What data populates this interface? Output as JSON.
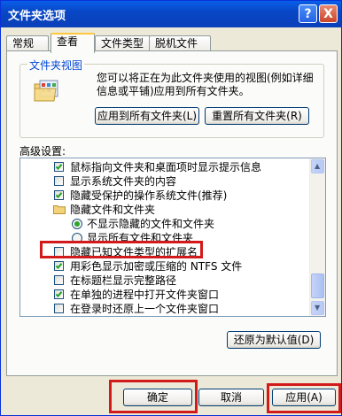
{
  "window": {
    "title": "文件夹选项",
    "help_label": "?",
    "close_label": "X"
  },
  "tabs": [
    {
      "label": "常规"
    },
    {
      "label": "查看"
    },
    {
      "label": "文件类型"
    },
    {
      "label": "脱机文件"
    }
  ],
  "folder_views": {
    "group_label": "文件夹视图",
    "description": "您可以将正在为此文件夹使用的视图(例如详细信息或平铺)应用到所有文件夹。",
    "apply_all_label": "应用到所有文件夹(L)",
    "reset_all_label": "重置所有文件夹(R)"
  },
  "advanced": {
    "label": "高级设置:",
    "items": [
      {
        "type": "checkbox",
        "checked": true,
        "label": "鼠标指向文件夹和桌面项时显示提示信息"
      },
      {
        "type": "checkbox",
        "checked": false,
        "label": "显示系统文件夹的内容"
      },
      {
        "type": "checkbox",
        "checked": true,
        "label": "隐藏受保护的操作系统文件(推荐)"
      },
      {
        "type": "folder",
        "label": "隐藏文件和文件夹"
      },
      {
        "type": "radio",
        "checked": true,
        "label": "不显示隐藏的文件和文件夹"
      },
      {
        "type": "radio",
        "checked": false,
        "label": "显示所有文件和文件夹"
      },
      {
        "type": "checkbox",
        "checked": false,
        "label": "隐藏已知文件类型的扩展名"
      },
      {
        "type": "checkbox",
        "checked": true,
        "label": "用彩色显示加密或压缩的 NTFS 文件"
      },
      {
        "type": "checkbox",
        "checked": false,
        "label": "在标题栏显示完整路径"
      },
      {
        "type": "checkbox",
        "checked": true,
        "label": "在单独的进程中打开文件夹窗口"
      },
      {
        "type": "checkbox",
        "checked": false,
        "label": "在登录时还原上一个文件夹窗口"
      }
    ],
    "restore_defaults_label": "还原为默认值(D)"
  },
  "footer": {
    "ok_label": "确定",
    "cancel_label": "取消",
    "apply_label": "应用(A)"
  },
  "colors": {
    "titlebar": "#0a4fd6",
    "highlight": "#d21a1a",
    "check": "#21a121"
  }
}
